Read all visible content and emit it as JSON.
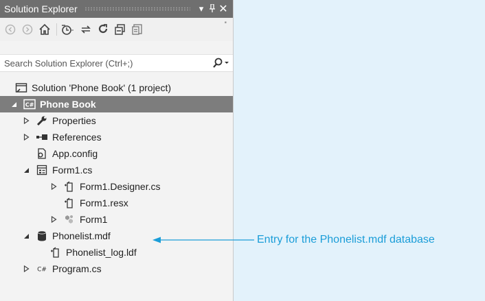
{
  "panel": {
    "title": "Solution Explorer",
    "dropdown_glyph": "▾",
    "pin_glyph": "ꟸ",
    "close_glyph": "✕"
  },
  "toolbar": {
    "icons": [
      "back-icon",
      "forward-icon",
      "home-icon",
      "pending-changes-icon",
      "sync-icon",
      "refresh-icon",
      "collapse-all-icon",
      "properties-icon"
    ],
    "overflow_glyph": "''"
  },
  "search": {
    "placeholder": "Search Solution Explorer (Ctrl+;)"
  },
  "tree": {
    "solution": "Solution 'Phone Book' (1 project)",
    "project": "Phone Book",
    "properties": "Properties",
    "references": "References",
    "app_config": "App.config",
    "form1_cs": "Form1.cs",
    "form1_designer": "Form1.Designer.cs",
    "form1_resx": "Form1.resx",
    "form1_class": "Form1",
    "phonelist_mdf": "Phonelist.mdf",
    "phonelist_log": "Phonelist_log.ldf",
    "program_cs": "Program.cs"
  },
  "callout": {
    "text": "Entry for the Phonelist.mdf database",
    "color": "#1a9dd8"
  },
  "colors": {
    "title_bar": "#6f6f6f",
    "selection": "#7d7d7d",
    "background": "#e3f2fb"
  }
}
